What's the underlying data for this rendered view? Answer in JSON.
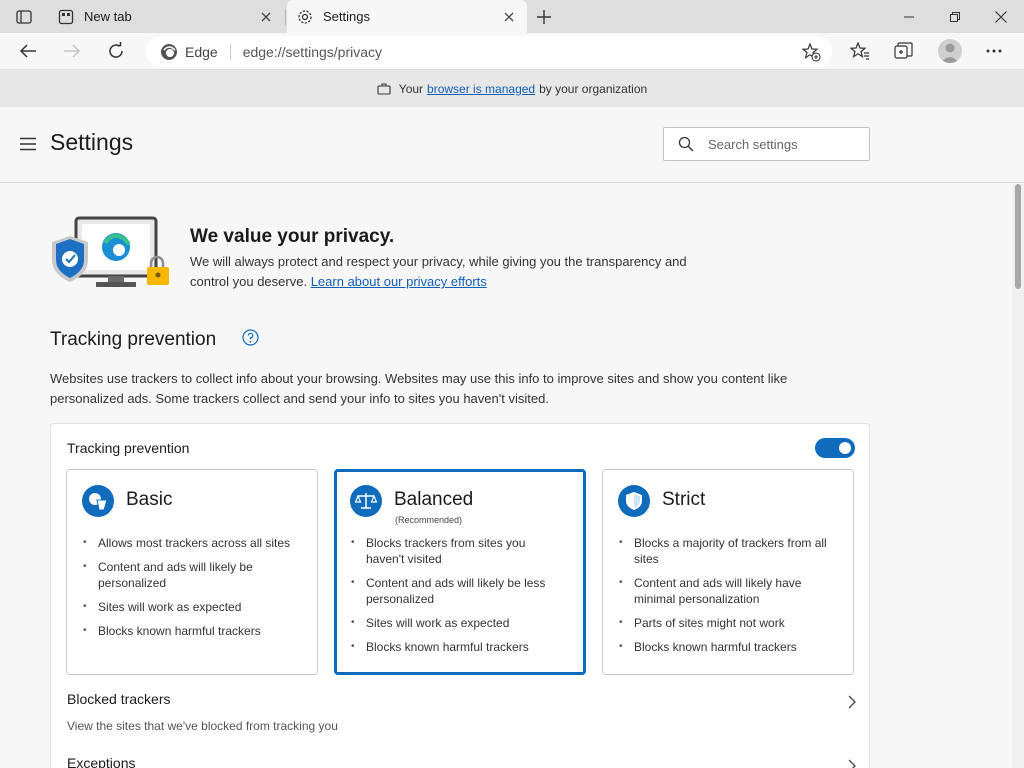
{
  "tabs": [
    {
      "label": "New tab",
      "icon": "newtab-icon",
      "active": false
    },
    {
      "label": "Settings",
      "icon": "gear-icon",
      "active": true
    }
  ],
  "address_bar": {
    "brand": "Edge",
    "url": "edge://settings/privacy"
  },
  "managed_bar": {
    "prefix": "Your",
    "link": "browser is managed",
    "suffix": "by your organization"
  },
  "header": {
    "title": "Settings",
    "search_placeholder": "Search settings"
  },
  "privacy_intro": {
    "title": "We value your privacy.",
    "text": "We will always protect and respect your privacy, while giving you the transparency and control you deserve.",
    "link": "Learn about our privacy efforts"
  },
  "tracking": {
    "section_title": "Tracking prevention",
    "description": "Websites use trackers to collect info about your browsing. Websites may use this info to improve sites and show you content like personalized ads. Some trackers collect and send your info to sites you haven't visited.",
    "card_title": "Tracking prevention",
    "enabled": true,
    "options": [
      {
        "name": "Basic",
        "subtitle": "",
        "selected": false,
        "bullets": [
          "Allows most trackers across all sites",
          "Content and ads will likely be personalized",
          "Sites will work as expected",
          "Blocks known harmful trackers"
        ]
      },
      {
        "name": "Balanced",
        "subtitle": "(Recommended)",
        "selected": true,
        "bullets": [
          "Blocks trackers from sites you haven't visited",
          "Content and ads will likely be less personalized",
          "Sites will work as expected",
          "Blocks known harmful trackers"
        ]
      },
      {
        "name": "Strict",
        "subtitle": "",
        "selected": false,
        "bullets": [
          "Blocks a majority of trackers from all sites",
          "Content and ads will likely have minimal personalization",
          "Parts of sites might not work",
          "Blocks known harmful trackers"
        ]
      }
    ],
    "blocked": {
      "title": "Blocked trackers",
      "subtitle": "View the sites that we've blocked from tracking you"
    },
    "exceptions": {
      "title": "Exceptions"
    }
  },
  "colors": {
    "accent": "#0f6cbd",
    "link": "#0f5fb8"
  }
}
